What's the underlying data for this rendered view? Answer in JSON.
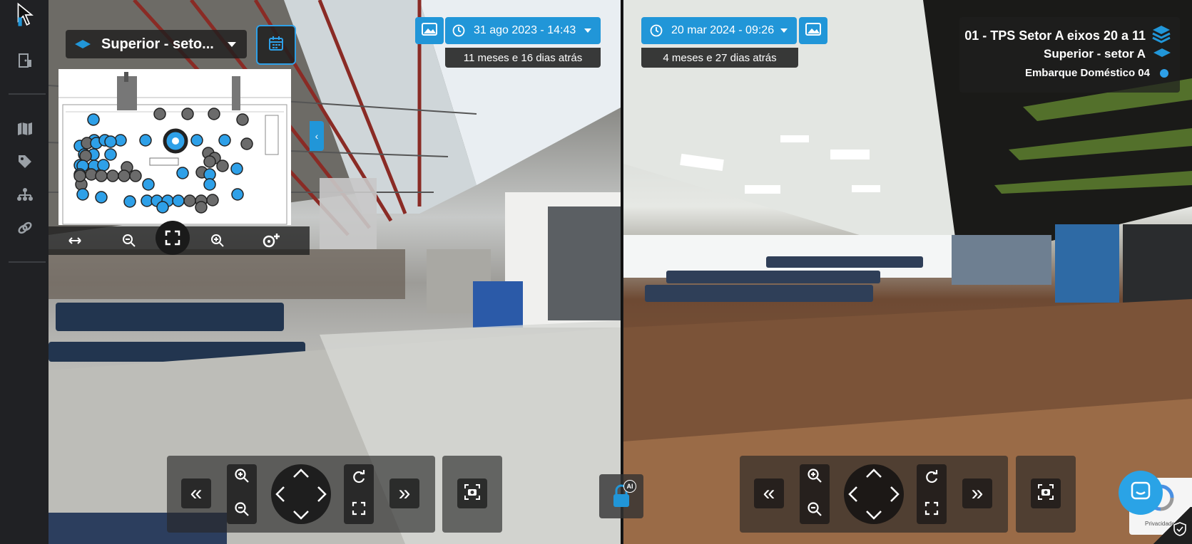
{
  "floor_selector": {
    "label": "Superior - seto...",
    "icon": "layers-diamond-icon"
  },
  "calendar_button": {
    "icon": "calendar-icon"
  },
  "minimap": {
    "tools": [
      "fit-width-icon",
      "zoom-out-icon",
      "fullscreen-icon",
      "zoom-in-icon",
      "add-point-icon"
    ]
  },
  "left_view": {
    "date": "31 ago 2023 - 14:43",
    "ago": "11 meses e 16 dias atrás"
  },
  "right_view": {
    "date": "20 mar 2024 - 09:26",
    "ago": "4 meses e 27 dias atrás"
  },
  "location": {
    "project": "01 - TPS Setor A eixos 20 a 11",
    "floor": "Superior - setor A",
    "point": "Embarque Doméstico 04"
  },
  "recaptcha": {
    "text": "Privacidade"
  },
  "ai_button": {
    "badge": "AI"
  },
  "colors": {
    "accent": "#2196d8",
    "sidebar": "#202124"
  }
}
